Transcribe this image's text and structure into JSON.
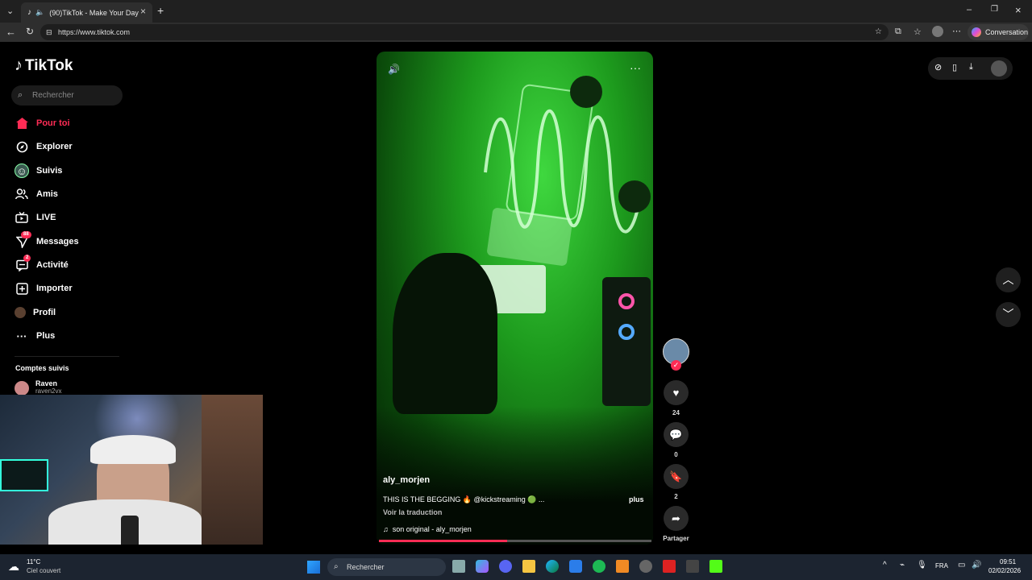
{
  "browser": {
    "tab_title": "(90)TikTok - Make Your Day",
    "url": "https://www.tiktok.com",
    "conversation_label": "Conversation"
  },
  "sidebar": {
    "logo": "TikTok",
    "search_placeholder": "Rechercher",
    "items": [
      {
        "label": "Pour toi",
        "icon": "home-icon"
      },
      {
        "label": "Explorer",
        "icon": "compass-icon"
      },
      {
        "label": "Suivis",
        "icon": "following-avatar-icon"
      },
      {
        "label": "Amis",
        "icon": "friends-icon"
      },
      {
        "label": "LIVE",
        "icon": "live-tv-icon"
      },
      {
        "label": "Messages",
        "icon": "send-icon",
        "badge": "88"
      },
      {
        "label": "Activité",
        "icon": "activity-icon",
        "badge": "2"
      },
      {
        "label": "Importer",
        "icon": "upload-plus-icon"
      },
      {
        "label": "Profil",
        "icon": "profile-avatar-icon"
      },
      {
        "label": "Plus",
        "icon": "more-dots-icon"
      }
    ],
    "following_header": "Comptes suivis",
    "following": [
      {
        "name": "Raven",
        "handle": "raven2vx"
      }
    ]
  },
  "video": {
    "author": "aly_morjen",
    "caption": "THIS IS THE BEGGING 🔥 @kickstreaming 🟢 ...",
    "more_label": "plus",
    "translate_label": "Voir la traduction",
    "sound": "son original - aly_morjen",
    "progress": 0.47
  },
  "actions": {
    "likes": "24",
    "comments": "0",
    "saves": "2",
    "share_label": "Partager"
  },
  "taskbar": {
    "weather_temp": "11°C",
    "weather_desc": "Ciel couvert",
    "search_label": "Rechercher",
    "lang": "FRA",
    "time": "09:51",
    "date": "02/02/2026"
  },
  "colors": {
    "accent": "#fe2c55",
    "background": "#000000"
  }
}
